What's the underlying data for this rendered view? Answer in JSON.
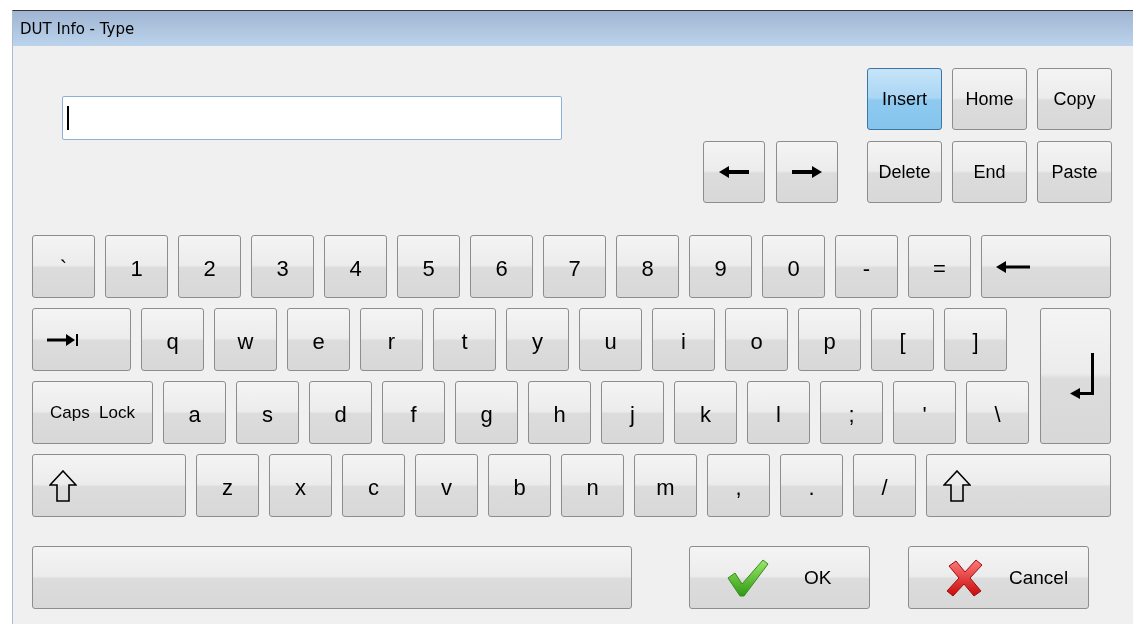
{
  "window": {
    "title": "DUT Info - Type"
  },
  "input": {
    "focused": true
  },
  "arrow_keys": [
    {
      "kind": "left"
    },
    {
      "kind": "right"
    }
  ],
  "edit_keys": [
    {
      "label": "Insert",
      "selected": true
    },
    {
      "label": "Home",
      "selected": false
    },
    {
      "label": "Copy",
      "selected": false
    },
    {
      "label": "Delete",
      "selected": false
    },
    {
      "label": "End",
      "selected": false
    },
    {
      "label": "Paste",
      "selected": false
    }
  ],
  "keyboard": {
    "rows": [
      [
        {
          "kind": "char",
          "label": "`"
        },
        {
          "kind": "char",
          "label": "1"
        },
        {
          "kind": "char",
          "label": "2"
        },
        {
          "kind": "char",
          "label": "3"
        },
        {
          "kind": "char",
          "label": "4"
        },
        {
          "kind": "char",
          "label": "5"
        },
        {
          "kind": "char",
          "label": "6"
        },
        {
          "kind": "char",
          "label": "7"
        },
        {
          "kind": "char",
          "label": "8"
        },
        {
          "kind": "char",
          "label": "9"
        },
        {
          "kind": "char",
          "label": "0"
        },
        {
          "kind": "char",
          "label": "-"
        },
        {
          "kind": "char",
          "label": "="
        },
        {
          "kind": "backspace"
        }
      ],
      [
        {
          "kind": "tab"
        },
        {
          "kind": "char",
          "label": "q"
        },
        {
          "kind": "char",
          "label": "w"
        },
        {
          "kind": "char",
          "label": "e"
        },
        {
          "kind": "char",
          "label": "r"
        },
        {
          "kind": "char",
          "label": "t"
        },
        {
          "kind": "char",
          "label": "y"
        },
        {
          "kind": "char",
          "label": "u"
        },
        {
          "kind": "char",
          "label": "i"
        },
        {
          "kind": "char",
          "label": "o"
        },
        {
          "kind": "char",
          "label": "p"
        },
        {
          "kind": "char",
          "label": "["
        },
        {
          "kind": "char",
          "label": "]"
        }
      ],
      [
        {
          "kind": "caps",
          "label": "Caps  Lock"
        },
        {
          "kind": "char",
          "label": "a"
        },
        {
          "kind": "char",
          "label": "s"
        },
        {
          "kind": "char",
          "label": "d"
        },
        {
          "kind": "char",
          "label": "f"
        },
        {
          "kind": "char",
          "label": "g"
        },
        {
          "kind": "char",
          "label": "h"
        },
        {
          "kind": "char",
          "label": "j"
        },
        {
          "kind": "char",
          "label": "k"
        },
        {
          "kind": "char",
          "label": "l"
        },
        {
          "kind": "char",
          "label": ";"
        },
        {
          "kind": "char",
          "label": "'"
        },
        {
          "kind": "char",
          "label": "\\"
        }
      ],
      [
        {
          "kind": "shift"
        },
        {
          "kind": "char",
          "label": "z"
        },
        {
          "kind": "char",
          "label": "x"
        },
        {
          "kind": "char",
          "label": "c"
        },
        {
          "kind": "char",
          "label": "v"
        },
        {
          "kind": "char",
          "label": "b"
        },
        {
          "kind": "char",
          "label": "n"
        },
        {
          "kind": "char",
          "label": "m"
        },
        {
          "kind": "char",
          "label": ","
        },
        {
          "kind": "char",
          "label": "."
        },
        {
          "kind": "char",
          "label": "/"
        },
        {
          "kind": "shift"
        }
      ]
    ],
    "side_key": {
      "kind": "enter"
    }
  },
  "space_bar": {
    "kind": "space"
  },
  "buttons": [
    {
      "kind": "ok",
      "label": "OK"
    },
    {
      "kind": "cancel",
      "label": "Cancel"
    }
  ]
}
